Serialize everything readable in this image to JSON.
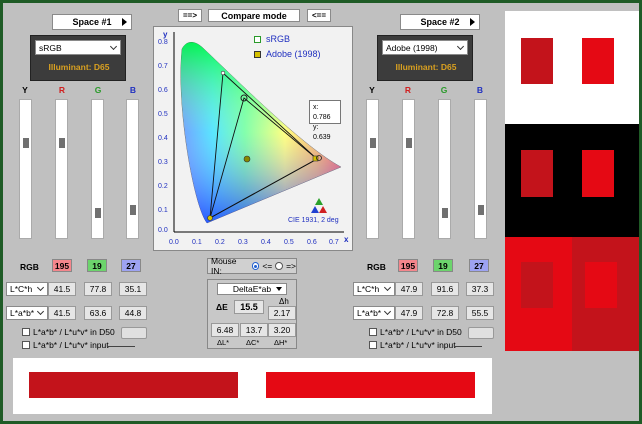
{
  "toolbar": {
    "left_arrow": "==>",
    "compare_mode": "Compare mode",
    "right_arrow": "<=="
  },
  "space1": {
    "title": "Space #1",
    "profile": "sRGB",
    "illuminant": "Illuminant: D65",
    "channels": [
      "Y",
      "R",
      "G",
      "B"
    ],
    "rgb_label": "RGB",
    "rgb": [
      "195",
      "19",
      "27"
    ],
    "lch_mode": "L*C*h",
    "lch": [
      "41.5",
      "77.8",
      "35.1"
    ],
    "lab_mode": "L*a*b*",
    "lab": [
      "41.5",
      "63.6",
      "44.8"
    ],
    "check1": "L*a*b* / L*u*v* in D50",
    "check2": "L*a*b* / L*u*v* input"
  },
  "space2": {
    "title": "Space #2",
    "profile": "Adobe (1998)",
    "illuminant": "Illuminant: D65",
    "channels": [
      "Y",
      "R",
      "G",
      "B"
    ],
    "rgb_label": "RGB",
    "rgb": [
      "195",
      "19",
      "27"
    ],
    "lch_mode": "L*C*h",
    "lch": [
      "47.9",
      "91.6",
      "37.3"
    ],
    "lab_mode": "L*a*b*",
    "lab": [
      "47.9",
      "72.8",
      "55.5"
    ],
    "check1": "L*a*b* / L*u*v* in D50",
    "check2": "L*a*b* / L*u*v* input"
  },
  "diagram": {
    "legend1": "sRGB",
    "legend2": "Adobe (1998)",
    "x_readout": "x: 0.786",
    "y_readout": "y: 0.639",
    "caption": "CIE 1931, 2 deg",
    "x_axis": "x",
    "y_axis": "y",
    "x_ticks": [
      "0.0",
      "0.1",
      "0.2",
      "0.3",
      "0.4",
      "0.5",
      "0.6",
      "0.7"
    ],
    "y_ticks": [
      "0.8",
      "0.7",
      "0.6",
      "0.5",
      "0.4",
      "0.3",
      "0.2",
      "0.1",
      "0.0"
    ]
  },
  "mouse_in": {
    "label": "Mouse IN:",
    "opt1": "<=",
    "opt2": "=>"
  },
  "delta": {
    "mode": "DeltaE*ab",
    "de_label": "ΔE",
    "de": "15.5",
    "dh_label": "Δh",
    "dh": "2.17",
    "dl": "6.48",
    "dc": "13.7",
    "dH": "3.20",
    "dl_label": "ΔL*",
    "dc_label": "ΔC*",
    "dH_label": "ΔH*"
  },
  "colors": {
    "swatch1": "#c3131b",
    "swatch2": "#e50914",
    "rgb_r": "#f4868c",
    "rgb_g": "#6cd46c",
    "rgb_b": "#9da3f2"
  }
}
